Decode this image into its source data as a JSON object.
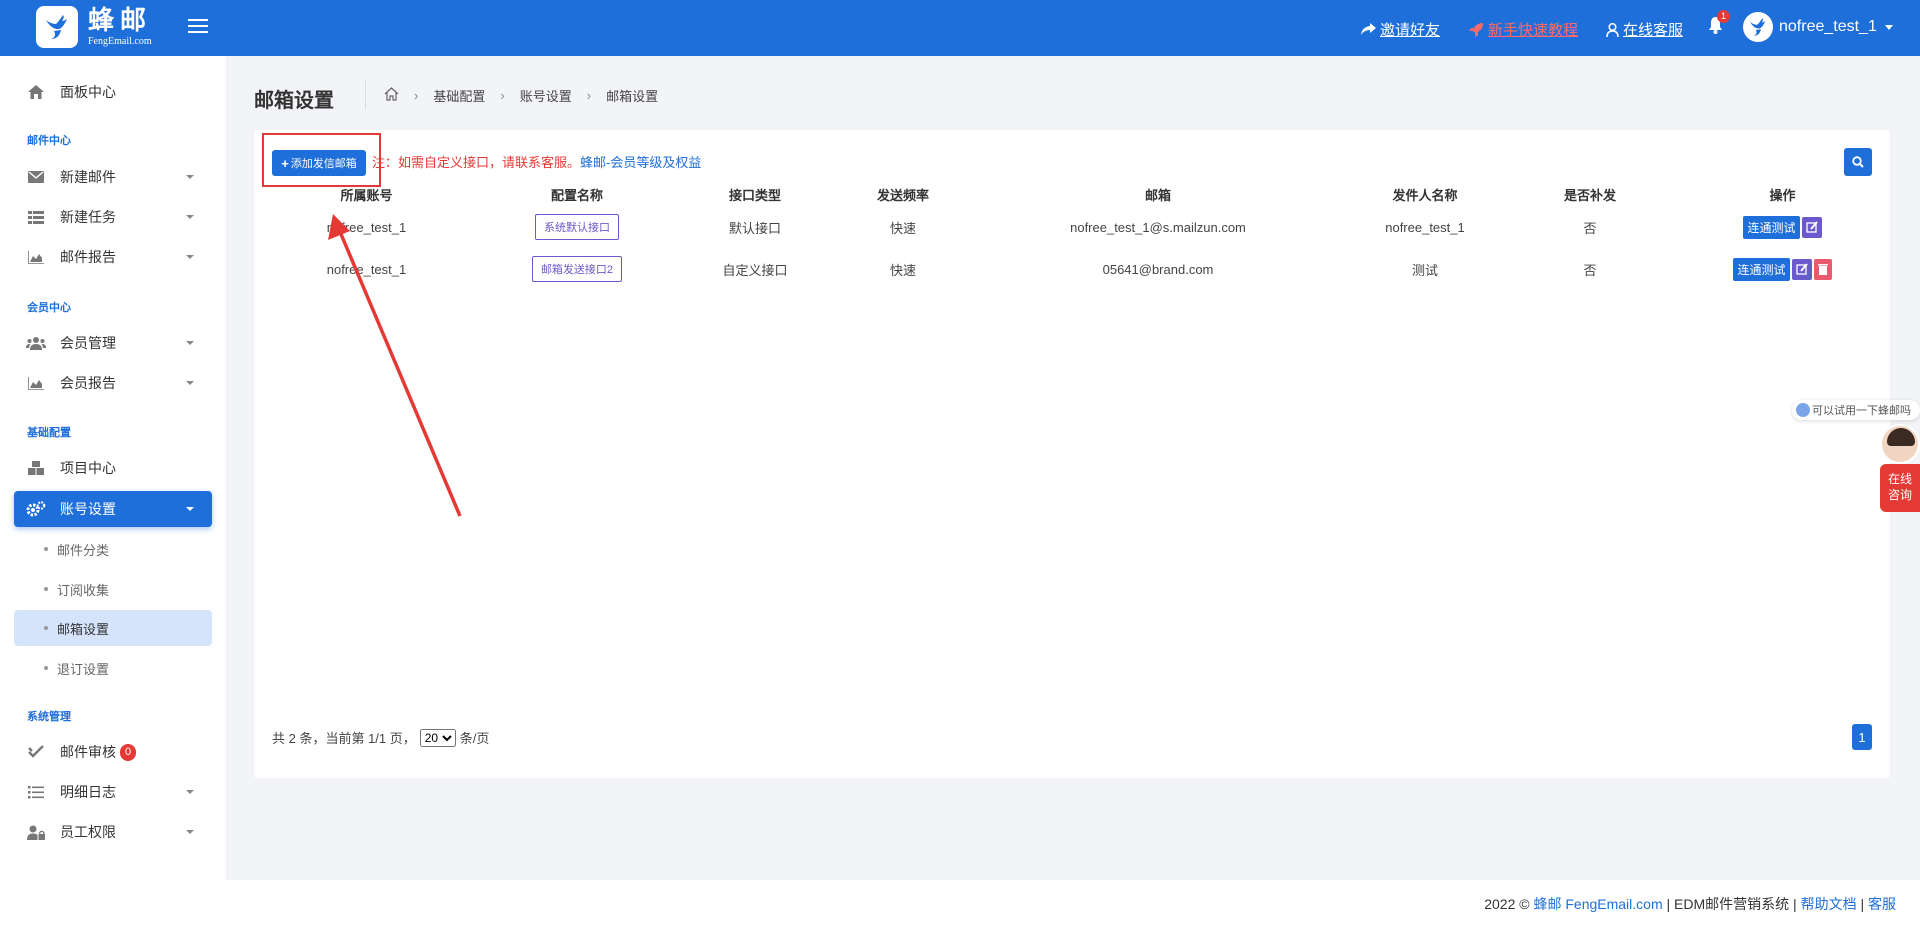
{
  "header": {
    "logo_cn": "蜂邮",
    "logo_en": "FengEmail.com",
    "invite": "邀请好友",
    "tutorial": "新手快速教程",
    "service": "在线客服",
    "bell_count": "1",
    "username": "nofree_test_1"
  },
  "sidebar": {
    "dashboard": "面板中心",
    "sec_mail": "邮件中心",
    "new_mail": "新建邮件",
    "new_task": "新建任务",
    "mail_report": "邮件报告",
    "sec_member": "会员中心",
    "member_manage": "会员管理",
    "member_report": "会员报告",
    "sec_base": "基础配置",
    "project_center": "项目中心",
    "account_settings": "账号设置",
    "sub_mail_category": "邮件分类",
    "sub_subscribe": "订阅收集",
    "sub_mailbox": "邮箱设置",
    "sub_unsubscribe": "退订设置",
    "sec_system": "系统管理",
    "mail_review": "邮件审核",
    "mail_review_count": "0",
    "detail_log": "明细日志",
    "staff_permission": "员工权限"
  },
  "page": {
    "title": "邮箱设置",
    "breadcrumb": [
      "基础配置",
      "账号设置",
      "邮箱设置"
    ]
  },
  "toolbar": {
    "add_button": "添加发信邮箱",
    "note_red": "注：如需自定义接口，请联系客服。",
    "note_link": "蜂邮-会员等级及权益"
  },
  "table": {
    "headers": [
      "所属账号",
      "配置名称",
      "接口类型",
      "发送频率",
      "邮箱",
      "发件人名称",
      "是否补发",
      "操作"
    ],
    "rows": [
      {
        "account": "nofree_test_1",
        "config": "系统默认接口",
        "type": "默认接口",
        "freq": "快速",
        "email": "nofree_test_1@s.mailzun.com",
        "sender": "nofree_test_1",
        "resend": "否",
        "test": "连通测试"
      },
      {
        "account": "nofree_test_1",
        "config": "邮箱发送接口2",
        "type": "自定义接口",
        "freq": "快速",
        "email": "05641@brand.com",
        "sender": "测试",
        "resend": "否",
        "test": "连通测试"
      }
    ]
  },
  "pager": {
    "info": "共 2 条，当前第 1/1 页，",
    "page_size": "20",
    "unit": "条/页",
    "current": "1"
  },
  "footer": {
    "prefix": "2022 © ",
    "brand": "蜂邮 FengEmail.com",
    "mid": " | EDM邮件营销系统 | ",
    "docs": "帮助文档",
    "sep": " | ",
    "service": "客服"
  },
  "widget": {
    "tooltip": "可以试用一下蜂邮吗",
    "line1": "在线",
    "line2": "咨询"
  },
  "colors": {
    "primary": "#1e6fd9",
    "danger": "#e53935",
    "purple": "#6a5acd"
  }
}
